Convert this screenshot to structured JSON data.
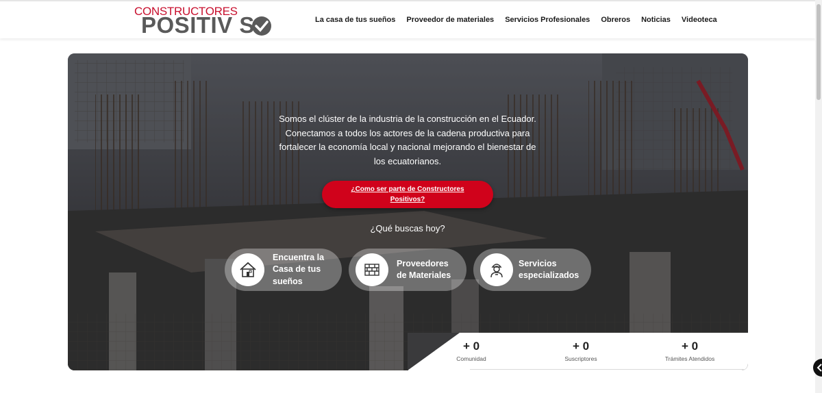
{
  "header": {
    "logo_top": "CONSTRUCTORES",
    "logo_bottom": "POSITIV S",
    "nav": [
      "La casa de tus sueños",
      "Proveedor de materiales",
      "Servicios Profesionales",
      "Obreros",
      "Noticias",
      "Videoteca"
    ]
  },
  "hero": {
    "intro": "Somos el clúster de la industria de la construcción en el Ecuador. Conectamos a todos los actores de la cadena productiva para fortalecer la economía local y nacional mejorando el bienestar de los ecuatorianos.",
    "cta_label": "¿Como ser parte de Constructores Positivos?",
    "question": "¿Qué buscas hoy?",
    "options": [
      {
        "label": "Encuentra la Casa de tus sueños",
        "icon": "house-icon"
      },
      {
        "label": "Proveedores de Materiales",
        "icon": "bricks-icon"
      },
      {
        "label": "Servicios especializados",
        "icon": "worker-icon"
      }
    ]
  },
  "stats": [
    {
      "value": "+ 0",
      "label": "Comunidad"
    },
    {
      "value": "+ 0",
      "label": "Suscriptores"
    },
    {
      "value": "+ 0",
      "label": "Trámites Atendidos"
    }
  ],
  "colors": {
    "accent": "#d0021b",
    "logo_gray": "#5a5a5a"
  }
}
